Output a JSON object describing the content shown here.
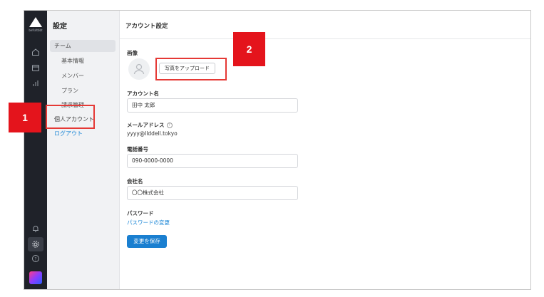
{
  "rail": {
    "logo_text": "befsdtbbt",
    "icons": [
      "home-icon",
      "calendar-icon",
      "chart-icon",
      "bell-icon",
      "gear-icon",
      "help-icon"
    ]
  },
  "submenu": {
    "title": "設定",
    "items": [
      {
        "label": "チーム",
        "type": "section"
      },
      {
        "label": "基本情報",
        "type": "sub"
      },
      {
        "label": "メンバー",
        "type": "sub"
      },
      {
        "label": "プラン",
        "type": "sub"
      },
      {
        "label": "請求管理",
        "type": "sub"
      },
      {
        "label": "個人アカウント",
        "type": "item"
      },
      {
        "label": "ログアウト",
        "type": "link"
      }
    ]
  },
  "main": {
    "header_title": "アカウント設定",
    "image_label": "画像",
    "upload_button": "写真をアップロード",
    "account_name_label": "アカウント名",
    "account_name_value": "田中 太郎",
    "email_label": "メールアドレス",
    "email_value": "yyyy@llddell.tokyo",
    "phone_label": "電話番号",
    "phone_value": "090-0000-0000",
    "company_label": "会社名",
    "company_value": "〇〇株式会社",
    "password_label": "パスワード",
    "password_link": "パスワードの変更",
    "save_button": "変更を保存"
  },
  "annotations": {
    "badge_1": "1",
    "badge_2": "2"
  },
  "colors": {
    "rail_bg": "#1f2229",
    "accent": "#1a7fd0",
    "annotation_red": "#e4141c"
  }
}
